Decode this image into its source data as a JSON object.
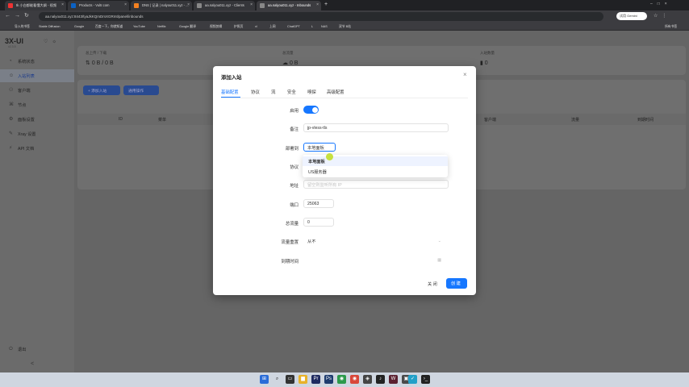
{
  "browser": {
    "tabs": [
      {
        "label": "tk 小白都能看懂大纲  - 视频",
        "active": false
      },
      {
        "label": "Products - Vultr.com",
        "active": false
      },
      {
        "label": "DNS | 记录 | nalyou011.xyz - ...",
        "active": false
      },
      {
        "label": "aa.nalyou011.xyz - Clients",
        "active": false
      },
      {
        "label": "aa.nalyou011.xyz - Inbounds",
        "active": true
      }
    ],
    "new_tab": "+",
    "url": "aa.nalyou011.xyz:8443/tyaJkKQmDmXGRmt/panel/inbounds",
    "gemini_label": "试用 Gemini",
    "bookmarks": [
      "导入的书签",
      "Stable Diffusion",
      "Google",
      "百度一下，你就知道",
      "YouTube",
      "Netflix",
      "Google 翻译",
      "视频剪辑",
      "护照页",
      "vl",
      "上网",
      "ChatGPT",
      "L",
      "NAS",
      "双节 B站"
    ],
    "bookmarks_right": "所有书签"
  },
  "app": {
    "brand": "3X-UI",
    "brand_sub": "v2.3.5",
    "sidebar": [
      {
        "label": "系统状态",
        "icon": "dashboard-icon"
      },
      {
        "label": "入站列表",
        "icon": "user-icon",
        "selected": true
      },
      {
        "label": "客户端",
        "icon": "team-icon"
      },
      {
        "label": "节点",
        "icon": "cluster-icon"
      },
      {
        "label": "面板设置",
        "icon": "setting-icon"
      },
      {
        "label": "Xray 设置",
        "icon": "tool-icon"
      },
      {
        "label": "API 文档",
        "icon": "api-icon"
      }
    ],
    "logout": "退出",
    "collapse": "<",
    "stats": [
      {
        "label": "总上传 / 下载",
        "value": "0 B / 0 B"
      },
      {
        "label": "总流量",
        "value": "0 B"
      },
      {
        "label": "入站数量",
        "value": "0"
      }
    ],
    "add_inbound_button": "+ 添加入站",
    "general_actions_button": "通用操作",
    "table_headers": [
      "ID",
      "菜单",
      "客户端",
      "流量",
      "到期时间"
    ]
  },
  "modal": {
    "title": "添加入站",
    "close": "×",
    "tabs": [
      "基础配置",
      "协议",
      "流",
      "安全",
      "嗅探",
      "高级配置"
    ],
    "fields": {
      "enable_label": "启用",
      "remark_label": "备注",
      "remark_value": "jp-vless-tls",
      "node_label": "部署到",
      "node_value": "本地面板",
      "protocol_label": "协议",
      "address_label": "地址",
      "address_placeholder": "留空则监听所有 IP",
      "port_label": "端口",
      "port_value": "25063",
      "total_label": "总流量",
      "total_value": "0",
      "reset_label": "流量重置",
      "reset_value": "从不",
      "expiry_label": "到期时间"
    },
    "dropdown_options": [
      "本地面板",
      "US服务器"
    ],
    "cancel": "关 闭",
    "create": "创 建"
  },
  "colors": {
    "primary": "#1677ff",
    "toggle_on": "#1677ff"
  }
}
